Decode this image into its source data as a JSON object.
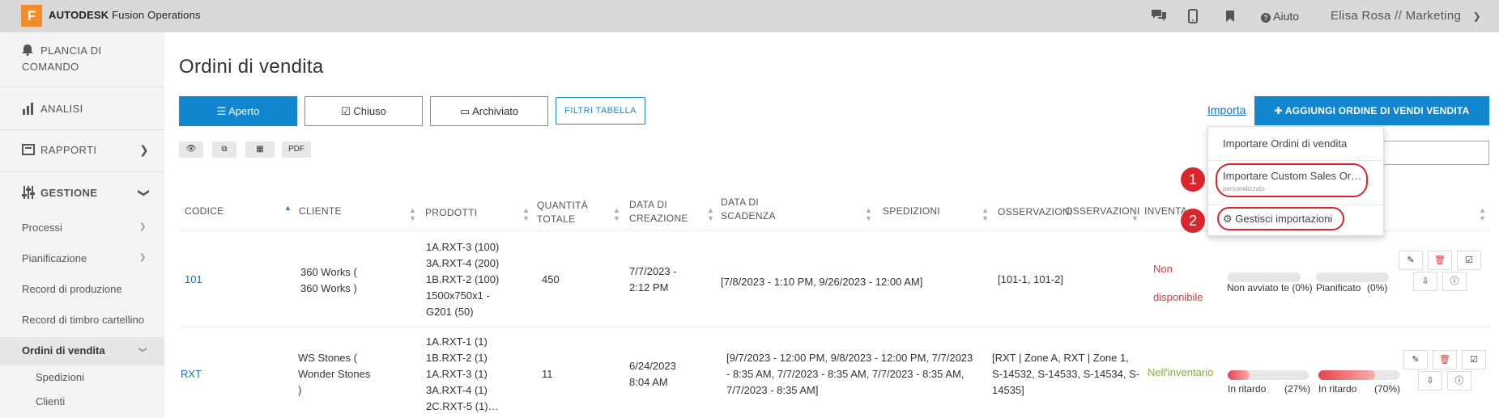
{
  "topbar": {
    "logo_letter": "F",
    "brand": "AUTODESK",
    "product": "Fusion Operations",
    "help_label": "Aiuto",
    "user": "Elisa Rosa // Marketing",
    "icons": [
      "chat-icon",
      "mobile-icon",
      "bookmark-icon",
      "question-icon",
      "chevron-down-icon"
    ]
  },
  "sidebar": {
    "dashboard_line1": "PLANCIA DI",
    "dashboard_line2": "COMANDO",
    "analysis": "ANALISI",
    "reports": "RAPPORTI",
    "management": "GESTIONE",
    "processes": "Processi",
    "planning": "Pianificazione",
    "production_record": "Record di produzione",
    "timeclock_record": "Record di timbro cartellino",
    "sales_orders": "Ordini di vendita",
    "shipments": "Spedizioni",
    "clients": "Clienti"
  },
  "main": {
    "title": "Ordini di vendita",
    "tabs": {
      "open": "Aperto",
      "closed": "Chiuso",
      "archived": "Archiviato"
    },
    "table_filters": "FILTRI TABELLA",
    "tools": {
      "pdf": "PDF"
    },
    "import_link": "Importa",
    "add_button": "AGGIUNGI ORDINE DI VENDI VENDITA"
  },
  "dropdown": {
    "item1": "Importare Ordini di vendita",
    "item2": "Importare Custom Sales Or…",
    "item2_sub": "personalizzato",
    "item3": "Gestisci importazioni",
    "badge1": "1",
    "badge2": "2",
    "highlight_color": "#d9262c"
  },
  "table": {
    "headers": {
      "code": "CODICE",
      "client": "CLIENTE",
      "products": "PRODOTTI",
      "qty1": "QUANTITÀ",
      "qty2": "TOTALE",
      "created1": "DATA DI",
      "created2": "CREAZIONE",
      "due1": "DATA DI",
      "due2": "SCADENZA",
      "shipments": "SPEDIZIONI",
      "obs1": "OSSERVAZIONI",
      "obs2": "OSSERVAZIONI",
      "inventory": "INVENTA"
    },
    "rows": [
      {
        "code": "101",
        "client1": "360 Works (",
        "client2": "360 Works )",
        "products": [
          "1A.RXT-3 (100)",
          "3A.RXT-4 (200)",
          "1B.RXT-2 (100)",
          "1500x750x1 -",
          "G201 (50)"
        ],
        "qty": "450",
        "created1": "7/7/2023 -",
        "created2": "2:12 PM",
        "due": "[7/8/2023 - 1:10 PM, 9/26/2023 - 12:00 AM]",
        "observations": "[101-1, 101-2]",
        "inventory1": "Non",
        "inventory2": "disponibile",
        "status1_label": "Non avviato",
        "status1_pct": "te (0%)",
        "status1_value": 0,
        "status2_label": "Pianificato",
        "status2_pct": "(0%)",
        "status2_value": 0
      },
      {
        "code": "RXT",
        "client1": "WS Stones (",
        "client2": "Wonder Stones",
        "client3": ")",
        "products": [
          "1A.RXT-1 (1)",
          "1B.RXT-2 (1)",
          "1A.RXT-3 (1)",
          "3A.RXT-4 (1)",
          "2C.RXT-5 (1)…"
        ],
        "qty": "11",
        "created1": "6/24/2023",
        "created2": "8:04 AM",
        "due1": "[9/7/2023 - 12:00 PM, 9/8/2023 - 12:00 PM, 7/7/2023",
        "due2": "- 8:35 AM, 7/7/2023 - 8:35 AM, 7/7/2023 - 8:35 AM,",
        "due3": "7/7/2023 - 8:35 AM]",
        "obs1": "[RXT | Zone A, RXT | Zone 1,",
        "obs2": "S-14532, S-14533, S-14534, S-",
        "obs3": "14535]",
        "inventory": "Nell'inventario",
        "status1_label": "In ritardo",
        "status1_pct": "(27%)",
        "status1_value": 27,
        "status2_label": "In ritardo",
        "status2_pct": "(70%)",
        "status2_value": 70
      }
    ]
  },
  "colors": {
    "primary": "#1287d0",
    "logo": "#f28c28",
    "danger": "#d93b3b",
    "success": "#7ab33a"
  }
}
